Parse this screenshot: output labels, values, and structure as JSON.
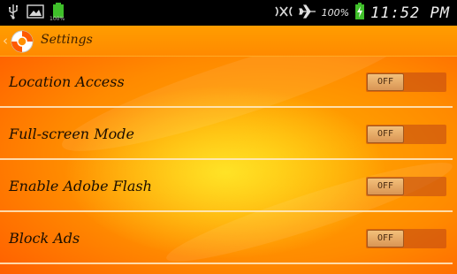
{
  "status_bar": {
    "battery_percent_text": "100%",
    "time": "11:52 PM",
    "small_battery_label": "100%"
  },
  "action_bar": {
    "title": "Settings"
  },
  "settings": [
    {
      "label": "Location Access",
      "state": "OFF"
    },
    {
      "label": "Full-screen Mode",
      "state": "OFF"
    },
    {
      "label": "Enable Adobe Flash",
      "state": "OFF"
    },
    {
      "label": "Block Ads",
      "state": "OFF"
    }
  ],
  "colors": {
    "status_bar": "#000000",
    "action_bar": "#ff9000",
    "background_center": "#ffd020",
    "background_edge": "#f04000",
    "battery_green": "#3fbf2a"
  }
}
